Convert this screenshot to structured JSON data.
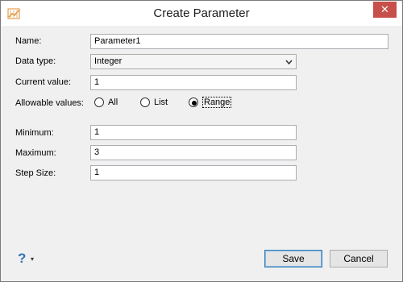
{
  "window": {
    "title": "Create Parameter",
    "close_symbol": "✕",
    "icon": "parameter-app-icon"
  },
  "form": {
    "name_label": "Name:",
    "name_value": "Parameter1",
    "data_type_label": "Data type:",
    "data_type_value": "Integer",
    "current_value_label": "Current value:",
    "current_value": "1",
    "allowable_label": "Allowable values:",
    "allowable_options": [
      "All",
      "List",
      "Range"
    ],
    "allowable_selected": "Range",
    "minimum_label": "Minimum:",
    "minimum_value": "1",
    "maximum_label": "Maximum:",
    "maximum_value": "3",
    "step_label": "Step Size:",
    "step_value": "1"
  },
  "footer": {
    "help_symbol": "?",
    "help_arrow": "▾",
    "save_label": "Save",
    "cancel_label": "Cancel"
  },
  "colors": {
    "close_bg": "#c7504a",
    "accent": "#2e74b5"
  }
}
